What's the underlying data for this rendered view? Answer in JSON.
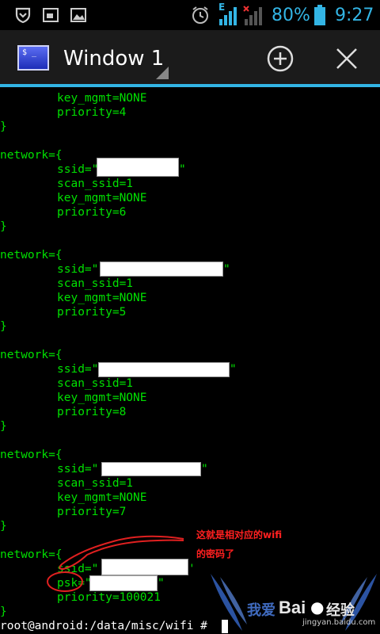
{
  "status_bar": {
    "network_type": "E",
    "battery_percent": "80%",
    "clock": "9:27",
    "icons": [
      "shield-icon",
      "gallery-icon",
      "picture-icon",
      "alarm-icon",
      "signal-icon",
      "no-signal-icon",
      "battery-icon"
    ]
  },
  "action_bar": {
    "title": "Window 1",
    "add_icon": "add-circle-icon",
    "close_icon": "close-icon"
  },
  "terminal": {
    "lines": [
      "key_mgmt=NONE",
      "priority=4",
      "}",
      "network={",
      "ssid=\"",
      "\"",
      "scan_ssid=1",
      "key_mgmt=NONE",
      "priority=6",
      "}",
      "network={",
      "ssid=\"",
      "\"",
      "scan_ssid=1",
      "key_mgmt=NONE",
      "priority=5",
      "}",
      "network={",
      "ssid=\"",
      "\"",
      "scan_ssid=1",
      "key_mgmt=NONE",
      "priority=8",
      "}",
      "network={",
      "ssid=\"",
      "\"",
      "scan_ssid=1",
      "key_mgmt=NONE",
      "priority=7",
      "}",
      "network={",
      "ssid=\"",
      "'",
      "psk=\"",
      "\"",
      "priority=100021",
      "}",
      "root@android:/data/misc/wifi #"
    ]
  },
  "annotation": {
    "line1": "这就是相对应的wifi",
    "line2": "的密码了"
  },
  "watermark": {
    "brand": "Bai",
    "brand_suffix": "经验",
    "prefix": "我爱",
    "url": "jingyan.baidu.com"
  }
}
